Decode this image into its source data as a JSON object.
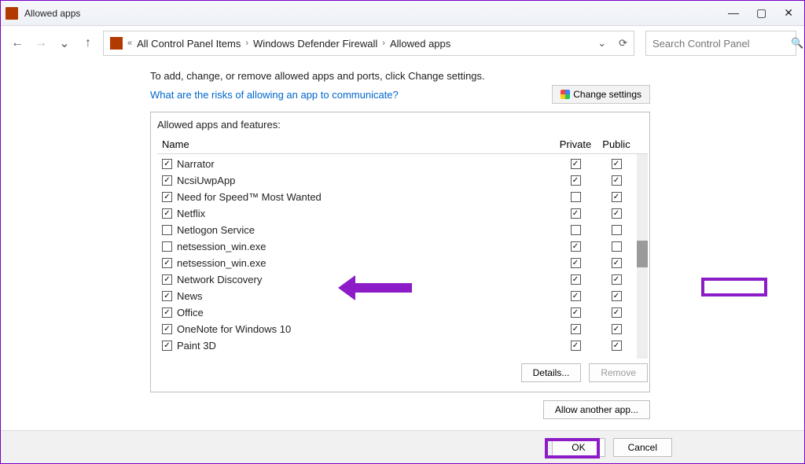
{
  "window": {
    "title": "Allowed apps"
  },
  "breadcrumbs": {
    "root": "All Control Panel Items",
    "mid": "Windows Defender Firewall",
    "leaf": "Allowed apps"
  },
  "search": {
    "placeholder": "Search Control Panel"
  },
  "intro": "To add, change, or remove allowed apps and ports, click Change settings.",
  "risklink": "What are the risks of allowing an app to communicate?",
  "change_settings": "Change settings",
  "panel_title": "Allowed apps and features:",
  "columns": {
    "name": "Name",
    "private": "Private",
    "public": "Public"
  },
  "apps": [
    {
      "name": "Narrator",
      "enabled": true,
      "private": true,
      "public": true
    },
    {
      "name": "NcsiUwpApp",
      "enabled": true,
      "private": true,
      "public": true
    },
    {
      "name": "Need for Speed™ Most Wanted",
      "enabled": true,
      "private": false,
      "public": true
    },
    {
      "name": "Netflix",
      "enabled": true,
      "private": true,
      "public": true
    },
    {
      "name": "Netlogon Service",
      "enabled": false,
      "private": false,
      "public": false
    },
    {
      "name": "netsession_win.exe",
      "enabled": false,
      "private": true,
      "public": false
    },
    {
      "name": "netsession_win.exe",
      "enabled": true,
      "private": true,
      "public": true
    },
    {
      "name": "Network Discovery",
      "enabled": true,
      "private": true,
      "public": true
    },
    {
      "name": "News",
      "enabled": true,
      "private": true,
      "public": true
    },
    {
      "name": "Office",
      "enabled": true,
      "private": true,
      "public": true
    },
    {
      "name": "OneNote for Windows 10",
      "enabled": true,
      "private": true,
      "public": true
    },
    {
      "name": "Paint 3D",
      "enabled": true,
      "private": true,
      "public": true
    }
  ],
  "buttons": {
    "details": "Details...",
    "remove": "Remove",
    "allow_another": "Allow another app...",
    "ok": "OK",
    "cancel": "Cancel"
  }
}
